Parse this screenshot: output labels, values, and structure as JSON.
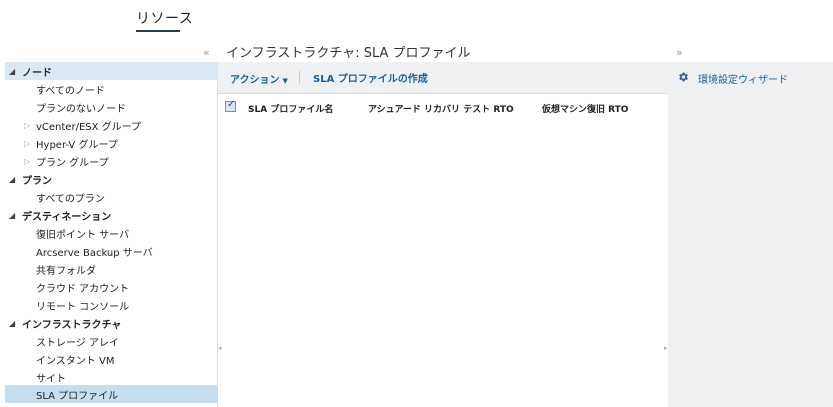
{
  "top_tab": {
    "label": "リソース"
  },
  "page": {
    "title": "インフラストラクチャ: SLA プロファイル",
    "collapse_left": "«",
    "collapse_right": "»"
  },
  "sidebar": {
    "groups": [
      {
        "label": "ノード",
        "items": [
          "すべてのノード",
          "プランのないノード",
          "vCenter/ESX グループ",
          "Hyper-V グループ",
          "プラン グループ"
        ]
      },
      {
        "label": "プラン",
        "items": [
          "すべてのプラン"
        ]
      },
      {
        "label": "デスティネーション",
        "items": [
          "復旧ポイント サーバ",
          "Arcserve Backup サーバ",
          "共有フォルダ",
          "クラウド アカウント",
          "リモート コンソール"
        ]
      },
      {
        "label": "インフラストラクチャ",
        "items": [
          "ストレージ アレイ",
          "インスタント VM",
          "サイト",
          "SLA プロファイル"
        ]
      }
    ],
    "selected_item": "SLA プロファイル"
  },
  "toolbar": {
    "action_label": "アクション",
    "create_label": "SLA プロファイルの作成"
  },
  "table": {
    "columns": [
      "SLA プロファイル名",
      "アシュアード リカバリ テスト RTO",
      "仮想マシン復旧 RTO"
    ],
    "rows": []
  },
  "right_panel": {
    "wizard_label": "環境設定ウィザード",
    "wizard_icon": "gear-icon"
  },
  "colors": {
    "link": "#1a5f9c",
    "selected_bg": "#c6dff0",
    "panel_bg": "#eef0f2"
  }
}
